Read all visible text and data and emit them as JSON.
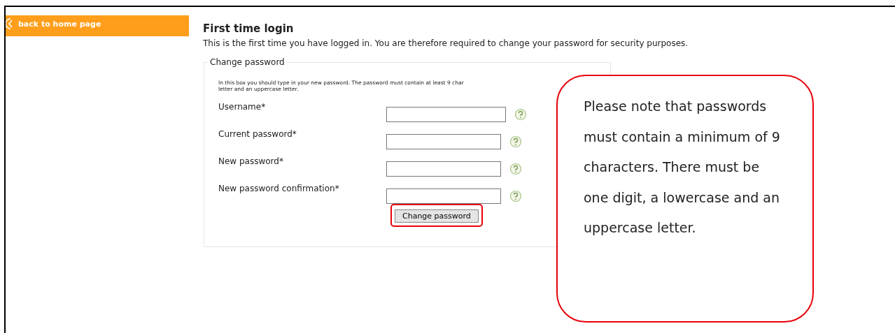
{
  "sidebar": {
    "back_link": "back to home page"
  },
  "page": {
    "title": "First time login",
    "intro": "This is the first time you have logged in. You are therefore required to change your password for security purposes."
  },
  "form": {
    "legend": "Change password",
    "instructions": [
      "In this box you should type in your new password. The password must contain at least 9 char",
      "letter and an uppercase letter."
    ],
    "fields": [
      {
        "label": "Username*"
      },
      {
        "label": "Current password*"
      },
      {
        "label": "New password*"
      },
      {
        "label": "New password confirmation*"
      }
    ],
    "submit": {
      "label": "Change password",
      "highlighted": true
    }
  },
  "callout": {
    "text": "Please note that passwords must contain a minimum of 9 characters. There must be one digit, a lowercase and an uppercase letter."
  }
}
